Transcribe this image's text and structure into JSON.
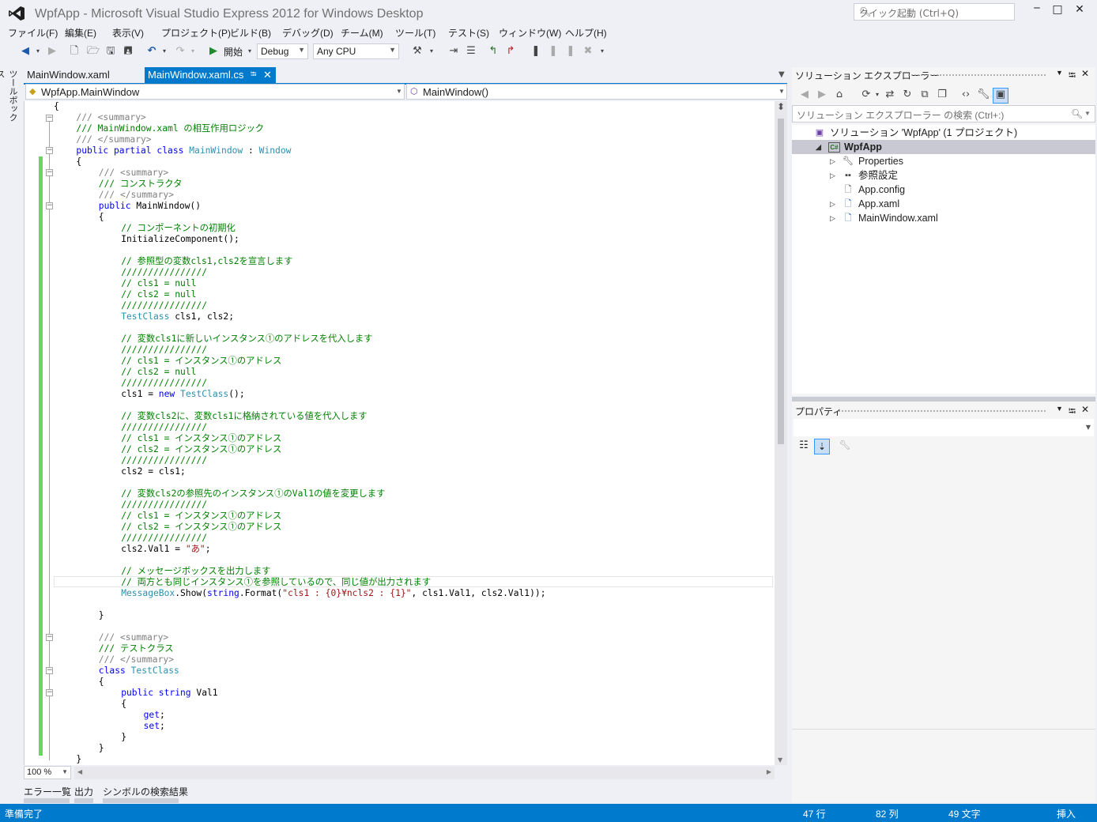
{
  "window": {
    "title": "WpfApp - Microsoft Visual Studio Express 2012 for Windows Desktop",
    "quick_launch_placeholder": "クイック起動 (Ctrl+Q)"
  },
  "menu": [
    "ファイル(F)",
    "編集(E)",
    "表示(V)",
    "プロジェクト(P)",
    "ビルド(B)",
    "デバッグ(D)",
    "チーム(M)",
    "ツール(T)",
    "テスト(S)",
    "ウィンドウ(W)",
    "ヘルプ(H)"
  ],
  "toolbar": {
    "start_label": "開始",
    "config": "Debug",
    "platform": "Any CPU"
  },
  "toolbox_label": "ツールボックス",
  "tabs": {
    "inactive": "MainWindow.xaml",
    "active": "MainWindow.xaml.cs",
    "pin": "ꟷ",
    "close": "✕"
  },
  "nav": {
    "type": "WpfApp.MainWindow",
    "member": "MainWindow()"
  },
  "code_lines": [
    {
      "y": 0,
      "x": 0,
      "parts": [
        [
          "tx",
          "{"
        ]
      ]
    },
    {
      "y": 1,
      "x": 4,
      "parts": [
        [
          "gy",
          "/// <summary>"
        ]
      ]
    },
    {
      "y": 2,
      "x": 4,
      "parts": [
        [
          "cm",
          "/// MainWindow.xaml の相互作用ロジック"
        ]
      ]
    },
    {
      "y": 3,
      "x": 4,
      "parts": [
        [
          "gy",
          "/// </summary>"
        ]
      ]
    },
    {
      "y": 4,
      "x": 4,
      "parts": [
        [
          "kw",
          "public partial class "
        ],
        [
          "ty",
          "MainWindow"
        ],
        [
          "tx",
          " : "
        ],
        [
          "ty",
          "Window"
        ]
      ]
    },
    {
      "y": 5,
      "x": 4,
      "parts": [
        [
          "tx",
          "{"
        ]
      ]
    },
    {
      "y": 6,
      "x": 8,
      "parts": [
        [
          "gy",
          "/// <summary>"
        ]
      ]
    },
    {
      "y": 7,
      "x": 8,
      "parts": [
        [
          "cm",
          "/// コンストラクタ"
        ]
      ]
    },
    {
      "y": 8,
      "x": 8,
      "parts": [
        [
          "gy",
          "/// </summary>"
        ]
      ]
    },
    {
      "y": 9,
      "x": 8,
      "parts": [
        [
          "kw",
          "public "
        ],
        [
          "tx",
          "MainWindow()"
        ]
      ]
    },
    {
      "y": 10,
      "x": 8,
      "parts": [
        [
          "tx",
          "{"
        ]
      ]
    },
    {
      "y": 11,
      "x": 12,
      "parts": [
        [
          "cm",
          "// コンポーネントの初期化"
        ]
      ]
    },
    {
      "y": 12,
      "x": 12,
      "parts": [
        [
          "tx",
          "InitializeComponent();"
        ]
      ]
    },
    {
      "y": 14,
      "x": 12,
      "parts": [
        [
          "cm",
          "// 参照型の変数cls1,cls2を宣言します"
        ]
      ]
    },
    {
      "y": 15,
      "x": 12,
      "parts": [
        [
          "cm",
          "////////////////"
        ]
      ]
    },
    {
      "y": 16,
      "x": 12,
      "parts": [
        [
          "cm",
          "// cls1 = null"
        ]
      ]
    },
    {
      "y": 17,
      "x": 12,
      "parts": [
        [
          "cm",
          "// cls2 = null"
        ]
      ]
    },
    {
      "y": 18,
      "x": 12,
      "parts": [
        [
          "cm",
          "////////////////"
        ]
      ]
    },
    {
      "y": 19,
      "x": 12,
      "parts": [
        [
          "ty",
          "TestClass"
        ],
        [
          "tx",
          " cls1, cls2;"
        ]
      ]
    },
    {
      "y": 21,
      "x": 12,
      "parts": [
        [
          "cm",
          "// 変数cls1に新しいインスタンス①のアドレスを代入します"
        ]
      ]
    },
    {
      "y": 22,
      "x": 12,
      "parts": [
        [
          "cm",
          "////////////////"
        ]
      ]
    },
    {
      "y": 23,
      "x": 12,
      "parts": [
        [
          "cm",
          "// cls1 = インスタンス①のアドレス"
        ]
      ]
    },
    {
      "y": 24,
      "x": 12,
      "parts": [
        [
          "cm",
          "// cls2 = null"
        ]
      ]
    },
    {
      "y": 25,
      "x": 12,
      "parts": [
        [
          "cm",
          "////////////////"
        ]
      ]
    },
    {
      "y": 26,
      "x": 12,
      "parts": [
        [
          "tx",
          "cls1 = "
        ],
        [
          "kw",
          "new "
        ],
        [
          "ty",
          "TestClass"
        ],
        [
          "tx",
          "();"
        ]
      ]
    },
    {
      "y": 28,
      "x": 12,
      "parts": [
        [
          "cm",
          "// 変数cls2に、変数cls1に格納されている値を代入します"
        ]
      ]
    },
    {
      "y": 29,
      "x": 12,
      "parts": [
        [
          "cm",
          "////////////////"
        ]
      ]
    },
    {
      "y": 30,
      "x": 12,
      "parts": [
        [
          "cm",
          "// cls1 = インスタンス①のアドレス"
        ]
      ]
    },
    {
      "y": 31,
      "x": 12,
      "parts": [
        [
          "cm",
          "// cls2 = インスタンス①のアドレス"
        ]
      ]
    },
    {
      "y": 32,
      "x": 12,
      "parts": [
        [
          "cm",
          "////////////////"
        ]
      ]
    },
    {
      "y": 33,
      "x": 12,
      "parts": [
        [
          "tx",
          "cls2 = cls1;"
        ]
      ]
    },
    {
      "y": 35,
      "x": 12,
      "parts": [
        [
          "cm",
          "// 変数cls2の参照先のインスタンス①のVal1の値を変更します"
        ]
      ]
    },
    {
      "y": 36,
      "x": 12,
      "parts": [
        [
          "cm",
          "////////////////"
        ]
      ]
    },
    {
      "y": 37,
      "x": 12,
      "parts": [
        [
          "cm",
          "// cls1 = インスタンス①のアドレス"
        ]
      ]
    },
    {
      "y": 38,
      "x": 12,
      "parts": [
        [
          "cm",
          "// cls2 = インスタンス①のアドレス"
        ]
      ]
    },
    {
      "y": 39,
      "x": 12,
      "parts": [
        [
          "cm",
          "////////////////"
        ]
      ]
    },
    {
      "y": 40,
      "x": 12,
      "parts": [
        [
          "tx",
          "cls2.Val1 = "
        ],
        [
          "st",
          "\"あ\""
        ],
        [
          "tx",
          ";"
        ]
      ]
    },
    {
      "y": 42,
      "x": 12,
      "parts": [
        [
          "cm",
          "// メッセージボックスを出力します"
        ]
      ]
    },
    {
      "y": 43,
      "x": 12,
      "parts": [
        [
          "cm",
          "// 両方とも同じインスタンス①を参照しているので、同じ値が出力されます"
        ]
      ]
    },
    {
      "y": 44,
      "x": 12,
      "parts": [
        [
          "ty",
          "MessageBox"
        ],
        [
          "tx",
          ".Show("
        ],
        [
          "kw",
          "string"
        ],
        [
          "tx",
          ".Format("
        ],
        [
          "st",
          "\"cls1 : {0}¥ncls2 : {1}\""
        ],
        [
          "tx",
          ", cls1.Val1, cls2.Val1));"
        ]
      ]
    },
    {
      "y": 46,
      "x": 8,
      "parts": [
        [
          "tx",
          "}"
        ]
      ]
    },
    {
      "y": 48,
      "x": 8,
      "parts": [
        [
          "gy",
          "/// <summary>"
        ]
      ]
    },
    {
      "y": 49,
      "x": 8,
      "parts": [
        [
          "cm",
          "/// テストクラス"
        ]
      ]
    },
    {
      "y": 50,
      "x": 8,
      "parts": [
        [
          "gy",
          "/// </summary>"
        ]
      ]
    },
    {
      "y": 51,
      "x": 8,
      "parts": [
        [
          "kw",
          "class "
        ],
        [
          "ty",
          "TestClass"
        ]
      ]
    },
    {
      "y": 52,
      "x": 8,
      "parts": [
        [
          "tx",
          "{"
        ]
      ]
    },
    {
      "y": 53,
      "x": 12,
      "parts": [
        [
          "kw",
          "public string "
        ],
        [
          "tx",
          "Val1"
        ]
      ]
    },
    {
      "y": 54,
      "x": 12,
      "parts": [
        [
          "tx",
          "{"
        ]
      ]
    },
    {
      "y": 55,
      "x": 16,
      "parts": [
        [
          "kw",
          "get"
        ],
        [
          "tx",
          ";"
        ]
      ]
    },
    {
      "y": 56,
      "x": 16,
      "parts": [
        [
          "kw",
          "set"
        ],
        [
          "tx",
          ";"
        ]
      ]
    },
    {
      "y": 57,
      "x": 12,
      "parts": [
        [
          "tx",
          "}"
        ]
      ]
    },
    {
      "y": 58,
      "x": 8,
      "parts": [
        [
          "tx",
          "}"
        ]
      ]
    },
    {
      "y": 59,
      "x": 4,
      "parts": [
        [
          "tx",
          "}"
        ]
      ]
    }
  ],
  "editor": {
    "zoom": "100 %"
  },
  "bottom_tabs": [
    "エラー一覧",
    "出力",
    "シンボルの検索結果"
  ],
  "status": {
    "ready": "準備完了",
    "line": "47 行",
    "col": "82 列",
    "char": "49 文字",
    "mode": "挿入"
  },
  "solution_explorer": {
    "title": "ソリューション エクスプローラー",
    "search_placeholder": "ソリューション エクスプローラー の検索 (Ctrl+:)",
    "items": [
      {
        "label": "ソリューション 'WpfApp' (1 プロジェクト)",
        "level": 0,
        "expander": "",
        "icon": "solution-icon"
      },
      {
        "label": "WpfApp",
        "level": 1,
        "expander": "open",
        "icon": "csharp-project-icon",
        "selected": true
      },
      {
        "label": "Properties",
        "level": 2,
        "expander": "closed",
        "icon": "wrench-icon"
      },
      {
        "label": "参照設定",
        "level": 2,
        "expander": "closed",
        "icon": "references-icon"
      },
      {
        "label": "App.config",
        "level": 2,
        "expander": "",
        "icon": "config-file-icon"
      },
      {
        "label": "App.xaml",
        "level": 2,
        "expander": "closed",
        "icon": "xaml-file-icon"
      },
      {
        "label": "MainWindow.xaml",
        "level": 2,
        "expander": "closed",
        "icon": "xaml-file-icon"
      }
    ]
  },
  "properties": {
    "title": "プロパティ"
  }
}
